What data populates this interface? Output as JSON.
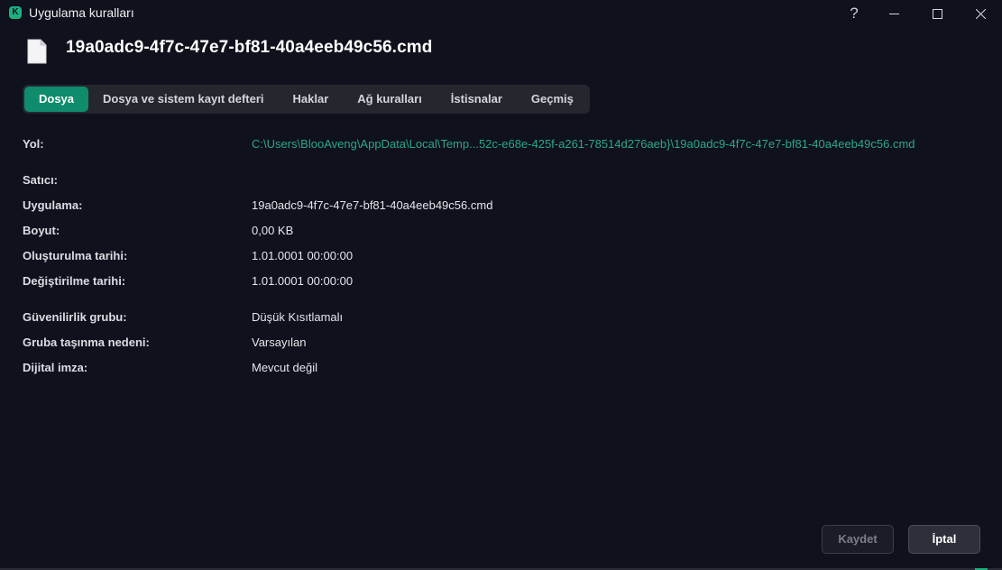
{
  "window": {
    "title": "Uygulama kuralları",
    "logo_letter": "K",
    "help_label": "?"
  },
  "header": {
    "file_name": "19a0adc9-4f7c-47e7-bf81-40a4eeb49c56.cmd"
  },
  "tabs": [
    {
      "label": "Dosya",
      "active": true
    },
    {
      "label": "Dosya ve sistem kayıt defteri",
      "active": false
    },
    {
      "label": "Haklar",
      "active": false
    },
    {
      "label": "Ağ kuralları",
      "active": false
    },
    {
      "label": "İstisnalar",
      "active": false
    },
    {
      "label": "Geçmiş",
      "active": false
    }
  ],
  "properties": {
    "path": {
      "label": "Yol:",
      "value": "C:\\Users\\BlooAveng\\AppData\\Local\\Temp...52c-e68e-425f-a261-78514d276aeb}\\19a0adc9-4f7c-47e7-bf81-40a4eeb49c56.cmd"
    },
    "vendor": {
      "label": "Satıcı:",
      "value": ""
    },
    "application": {
      "label": "Uygulama:",
      "value": "19a0adc9-4f7c-47e7-bf81-40a4eeb49c56.cmd"
    },
    "size": {
      "label": "Boyut:",
      "value": "0,00 KB"
    },
    "created": {
      "label": "Oluşturulma tarihi:",
      "value": "1.01.0001 00:00:00"
    },
    "modified": {
      "label": "Değiştirilme tarihi:",
      "value": "1.01.0001 00:00:00"
    },
    "trust_group": {
      "label": "Güvenilirlik grubu:",
      "value": "Düşük Kısıtlamalı"
    },
    "move_reason": {
      "label": "Gruba taşınma nedeni:",
      "value": "Varsayılan"
    },
    "signature": {
      "label": "Dijital imza:",
      "value": "Mevcut değil"
    }
  },
  "footer": {
    "save_label": "Kaydet",
    "cancel_label": "İptal"
  },
  "colors": {
    "accent": "#0f8c6b",
    "link": "#2ca888",
    "background": "#0f111c"
  }
}
